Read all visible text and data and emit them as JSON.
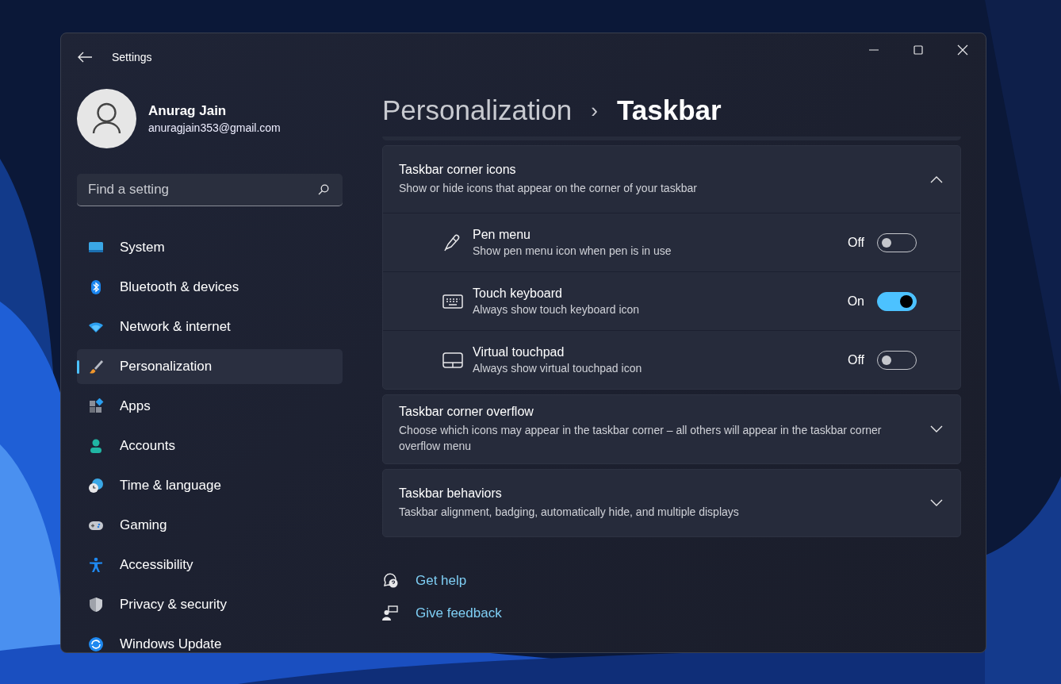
{
  "window": {
    "title": "Settings"
  },
  "profile": {
    "name": "Anurag Jain",
    "email": "anuragjain353@gmail.com"
  },
  "search": {
    "placeholder": "Find a setting"
  },
  "nav": [
    {
      "label": "System",
      "selected": false
    },
    {
      "label": "Bluetooth & devices",
      "selected": false
    },
    {
      "label": "Network & internet",
      "selected": false
    },
    {
      "label": "Personalization",
      "selected": true
    },
    {
      "label": "Apps",
      "selected": false
    },
    {
      "label": "Accounts",
      "selected": false
    },
    {
      "label": "Time & language",
      "selected": false
    },
    {
      "label": "Gaming",
      "selected": false
    },
    {
      "label": "Accessibility",
      "selected": false
    },
    {
      "label": "Privacy & security",
      "selected": false
    },
    {
      "label": "Windows Update",
      "selected": false
    }
  ],
  "breadcrumb": {
    "parent": "Personalization",
    "separator": "›",
    "current": "Taskbar"
  },
  "sections": [
    {
      "title": "Taskbar corner icons",
      "description": "Show or hide icons that appear on the corner of your taskbar",
      "expanded": true,
      "rows": [
        {
          "title": "Pen menu",
          "description": "Show pen menu icon when pen is in use",
          "state_label": "Off",
          "on": false
        },
        {
          "title": "Touch keyboard",
          "description": "Always show touch keyboard icon",
          "state_label": "On",
          "on": true
        },
        {
          "title": "Virtual touchpad",
          "description": "Always show virtual touchpad icon",
          "state_label": "Off",
          "on": false
        }
      ]
    },
    {
      "title": "Taskbar corner overflow",
      "description": "Choose which icons may appear in the taskbar corner – all others will appear in the taskbar corner overflow menu",
      "expanded": false
    },
    {
      "title": "Taskbar behaviors",
      "description": "Taskbar alignment, badging, automatically hide, and multiple displays",
      "expanded": false
    }
  ],
  "links": [
    {
      "label": "Get help"
    },
    {
      "label": "Give feedback"
    }
  ]
}
